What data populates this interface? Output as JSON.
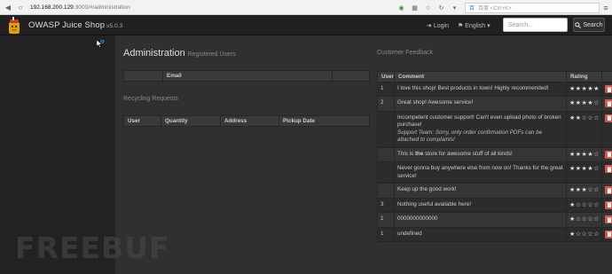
{
  "browser": {
    "url_host": "192.168.200.129",
    "url_rest": ":3000/#/administration",
    "search_placeholder": "百度 <Ctrl+K>",
    "search_engine_label": "百"
  },
  "navbar": {
    "app_name": "OWASP Juice Shop",
    "version": "v5.0.3",
    "login_label": "Login",
    "language_label": "English",
    "search_placeholder": "Search...",
    "search_button_label": "Search"
  },
  "admin": {
    "title": "Administration",
    "subtitle": "Registered Users",
    "users_header": [
      "Email"
    ],
    "recycling_title": "Recycling Requests",
    "recycling_headers": [
      "User",
      "Quantity",
      "Address",
      "Pickup Date"
    ]
  },
  "feedback": {
    "title": "Customer Feedback",
    "headers": {
      "user": "User",
      "comment": "Comment",
      "rating": "Rating"
    },
    "rows": [
      {
        "user": "1",
        "comment": "I love this shop! Best products in town! Highly recommended!",
        "rating": 5
      },
      {
        "user": "2",
        "comment": "Great shop! Awesome service!",
        "rating": 4
      },
      {
        "user": "",
        "comment": "Incompetent customer support! Can't even upload photo of broken purchase!",
        "comment_extra": "Support Team: Sorry, only order confirmation PDFs can be attached to complaints!",
        "rating": 2
      },
      {
        "user": "",
        "comment_pre": "This is ",
        "comment_bold": "the",
        "comment_post": " store for awesome stuff of all kinds!",
        "rating": 4
      },
      {
        "user": "",
        "comment": "Never gonna buy anywhere else from now on! Thanks for the great service!",
        "rating": 4
      },
      {
        "user": "",
        "comment": "Keep up the good work!",
        "rating": 3
      },
      {
        "user": "3",
        "comment": "Nothing useful available here!",
        "rating": 1
      },
      {
        "user": "1",
        "comment": "0000000000000",
        "rating": 1
      },
      {
        "user": "1",
        "comment": "undefined",
        "rating": 1
      }
    ]
  },
  "watermark": "FREEBUF",
  "colors": {
    "delete": "#d9534f",
    "navbar": "#202020",
    "background": "#303030"
  }
}
